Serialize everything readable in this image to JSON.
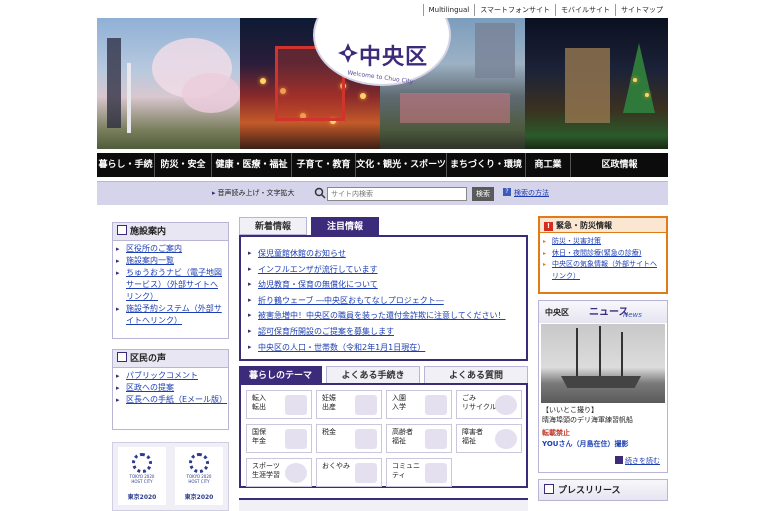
{
  "utility_links": [
    "Multilingual",
    "スマートフォンサイト",
    "モバイルサイト",
    "サイトマップ"
  ],
  "logo": {
    "title": "中央区",
    "subtitle": "Welcome to Chuo City"
  },
  "nav": [
    "暮らし・手続き",
    "防災・安全",
    "健康・医療・福祉",
    "子育て・教育",
    "文化・観光・スポーツ",
    "まちづくり・環境",
    "商工業",
    "区政情報"
  ],
  "search": {
    "voice_label": "音声読み上げ・文字拡大",
    "placeholder": "サイト内検索",
    "button": "検索",
    "help": "検索の方法"
  },
  "sidebar": {
    "facilities": {
      "title": "施設案内",
      "items": [
        "区役所のご案内",
        "施設案内一覧",
        "ちゅうおうナビ（電子地図サービス）（外部サイトへリンク）",
        "施設予約システム（外部サイトへリンク）"
      ]
    },
    "voices": {
      "title": "区民の声",
      "items": [
        "パブリックコメント",
        "区政への提案",
        "区長への手紙（Eメール版）"
      ]
    },
    "olympic": [
      {
        "line1": "TOKYO 2020",
        "line2": "HOST CITY",
        "label": "東京2020"
      },
      {
        "line1": "TOKYO 2020",
        "line2": "HOST CITY",
        "label": "東京2020"
      }
    ]
  },
  "news": {
    "tabs": [
      "新着情報",
      "注目情報"
    ],
    "active_tab": 1,
    "items": [
      "保児童館休館のお知らせ",
      "インフルエンザが流行しています",
      "幼児教育・保育の無償化について",
      "折り鶴ウェーブ ―中央区おもてなしプロジェクト―",
      "被害急増中！中央区の職員を装った還付金詐欺に注意してください！",
      "認可保育所開設のご提案を募集します",
      "中央区の人口・世帯数（令和2年1月1日現在）"
    ]
  },
  "themes": {
    "tabs": [
      "暮らしのテーマ",
      "よくある手続き",
      "よくある質問"
    ],
    "active_tab": 0,
    "tiles": [
      {
        "label": "転入\n転出",
        "icon": "house-icon"
      },
      {
        "label": "妊娠\n出産",
        "icon": "baby-bottle-icon"
      },
      {
        "label": "入園\n入学",
        "icon": "school-bag-icon"
      },
      {
        "label": "ごみ\nリサイクル",
        "icon": "recycle-icon"
      },
      {
        "label": "国保\n年金",
        "icon": "document-icon"
      },
      {
        "label": "税金",
        "icon": "tax-icon"
      },
      {
        "label": "高齢者\n福祉",
        "icon": "elderly-icon"
      },
      {
        "label": "障害者\n福祉",
        "icon": "wheelchair-icon"
      },
      {
        "label": "スポーツ\n生涯学習",
        "icon": "ball-icon"
      },
      {
        "label": "おくやみ",
        "icon": "flower-icon"
      },
      {
        "label": "コミュニ\nティ",
        "icon": "community-icon"
      }
    ]
  },
  "alert": {
    "title": "緊急・防災情報",
    "items": [
      "防災・災害対策",
      "休日・夜間診療(緊急の診療)",
      "中央区の気象情報（外部サイトへリンク）"
    ]
  },
  "city_news": {
    "title_jp": "中央区",
    "title_kana": "ニュース",
    "title_en": "News",
    "caption_line1": "【いいとこ撮り】",
    "caption_line2": "晴海埠頭のデリ海軍練習帆船",
    "reprint": "転載禁止",
    "credit": "YOUさん（月島在住）撮影",
    "more": "続きを読む"
  },
  "press": {
    "title": "プレスリリース"
  },
  "colors": {
    "brand": "#3c2a7a",
    "alert": "#e07c18",
    "link": "#1d3fb3"
  }
}
